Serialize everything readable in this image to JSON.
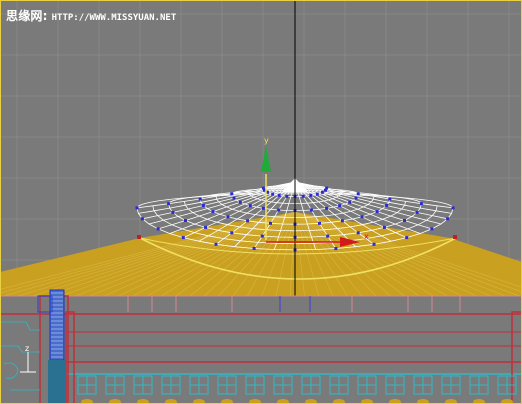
{
  "watermark": {
    "brand": "思缘网:",
    "url": "HTTP://WWW.MISSYUAN.NET"
  },
  "gizmo": {
    "y_label": "y",
    "x_label": "x"
  },
  "corner_axis": {
    "z_label": "z"
  },
  "colors": {
    "viewport_bg": "#7a7a7a",
    "grid": "#8c8c8c",
    "ground": "#c9a020",
    "mesh": "#ffffff",
    "selection_outline": "#f0e060",
    "gizmo_y": "#1faa3a",
    "gizmo_x": "#d11a1a",
    "vertex": "#2a2ad6",
    "wall_red": "#c0303a",
    "wall_cyan": "#30b8c8",
    "wall_blue": "#2030c0"
  }
}
